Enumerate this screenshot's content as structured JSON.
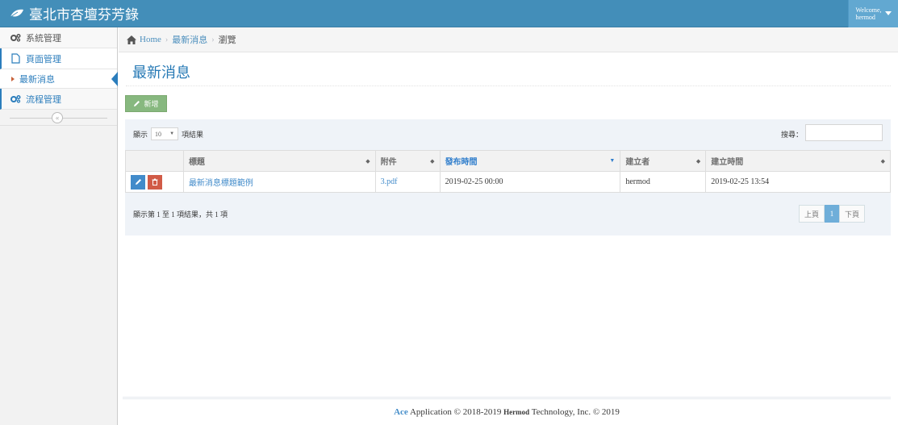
{
  "app": {
    "title": "臺北市杏壇芬芳錄",
    "welcome": "Welcome,",
    "username": "hermod"
  },
  "sidebar": {
    "items": [
      {
        "label": "系統管理"
      },
      {
        "label": "頁面管理"
      },
      {
        "label": "最新消息"
      },
      {
        "label": "流程管理"
      }
    ]
  },
  "breadcrumb": {
    "home": "Home",
    "section": "最新消息",
    "current": "瀏覽"
  },
  "page": {
    "title": "最新消息",
    "add_label": "新增"
  },
  "table": {
    "length_prefix": "顯示",
    "length_value": "10",
    "length_suffix": "項結果",
    "search_label": "搜尋：",
    "headers": [
      "標題",
      "附件",
      "發布時間",
      "建立者",
      "建立時間"
    ],
    "rows": [
      {
        "title": "最新消息標題範例",
        "attachment": "3.pdf",
        "published": "2019-02-25 00:00",
        "creator": "hermod",
        "created": "2019-02-25 13:54"
      }
    ],
    "info": "顯示第 1 至 1 項結果，共 1 項",
    "pager": {
      "prev": "上頁",
      "page": "1",
      "next": "下頁"
    }
  },
  "footer": {
    "ace": "Ace",
    "text1": "Application © 2018-2019",
    "company": "Hermod",
    "text2": "Technology, Inc. © 2019"
  },
  "colors": {
    "navbar": "#438eb9",
    "accent": "#2679b5",
    "add_button": "#87b87f",
    "delete_button": "#d15b47"
  }
}
